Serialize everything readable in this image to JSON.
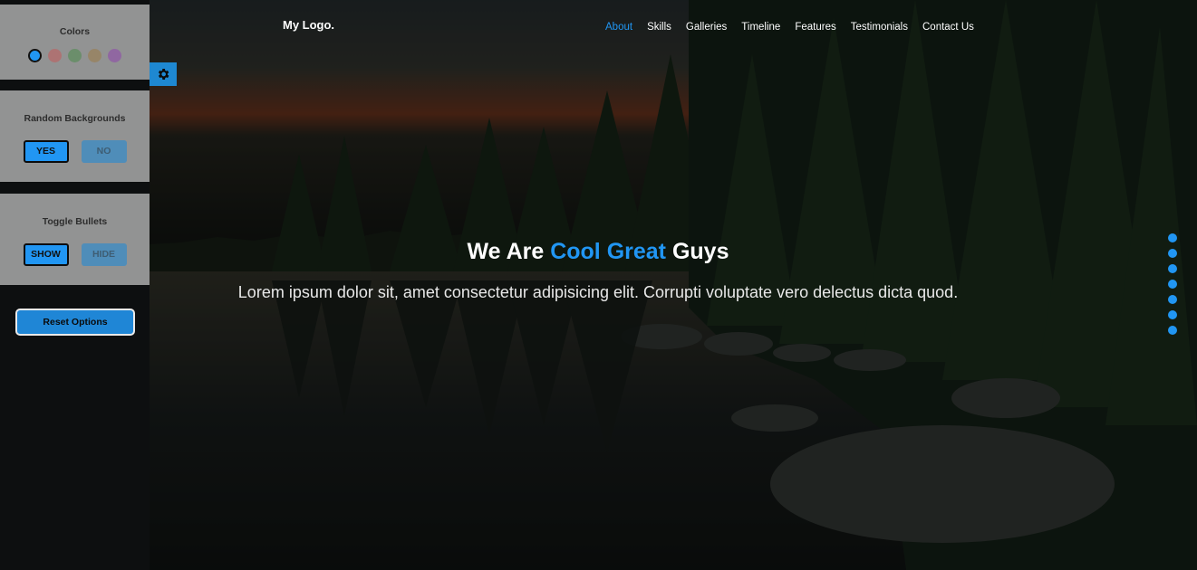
{
  "header": {
    "logo": "My Logo.",
    "nav": [
      {
        "label": "About",
        "active": true
      },
      {
        "label": "Skills",
        "active": false
      },
      {
        "label": "Galleries",
        "active": false
      },
      {
        "label": "Timeline",
        "active": false
      },
      {
        "label": "Features",
        "active": false
      },
      {
        "label": "Testimonials",
        "active": false
      },
      {
        "label": "Contact Us",
        "active": false
      }
    ]
  },
  "intro": {
    "title_before": "We Are ",
    "title_highlight": "Cool Great",
    "title_after": " Guys",
    "text": "Lorem ipsum dolor sit, amet consectetur adipisicing elit. Corrupti voluptate vero delectus dicta quod."
  },
  "settings": {
    "colors_title": "Colors",
    "colors": [
      "#2196f3",
      "#c25a5a",
      "#4a8a4a",
      "#9a7a45",
      "#8e44ad"
    ],
    "active_color_index": 0,
    "backgrounds_title": "Random Backgrounds",
    "backgrounds_yes": "YES",
    "backgrounds_no": "NO",
    "bullets_title": "Toggle Bullets",
    "bullets_show": "SHOW",
    "bullets_hide": "HIDE",
    "reset_label": "Reset Options"
  },
  "bullets_count": 7,
  "theme": {
    "accent": "#2196f3"
  }
}
